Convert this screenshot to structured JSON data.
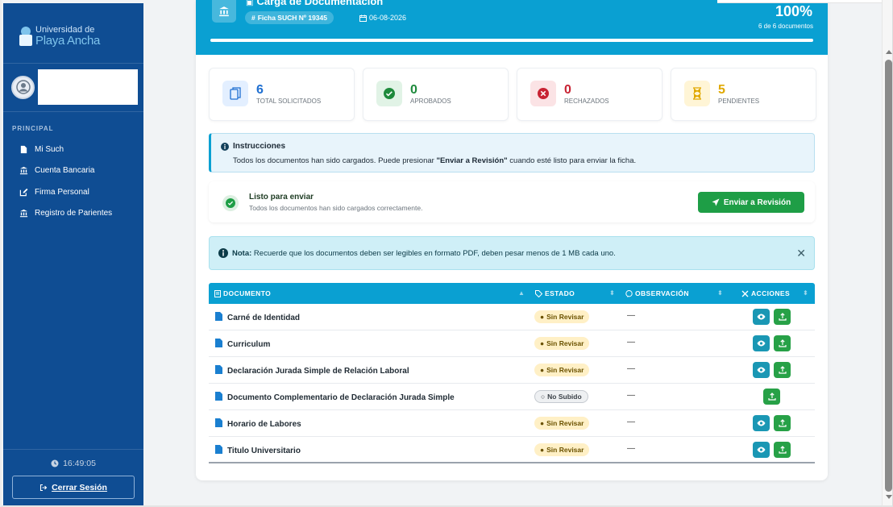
{
  "sidebar": {
    "brand_line1": "Universidad de",
    "brand_line2": "Playa Ancha",
    "section": "PRINCIPAL",
    "items": [
      {
        "label": "Mi Such",
        "icon": "file-icon"
      },
      {
        "label": "Cuenta Bancaria",
        "icon": "bank-icon"
      },
      {
        "label": "Firma Personal",
        "icon": "edit-icon"
      },
      {
        "label": "Registro de Parientes",
        "icon": "bank-icon"
      }
    ],
    "clock": "16:49:05",
    "logout": "Cerrar Sesión"
  },
  "header": {
    "title": "Carga de Documentación",
    "ficha": "Ficha SUCH Nº 19345",
    "date": "06-08-2026",
    "percent": "100%",
    "progress_fraction": 1.0,
    "docs_count": "6 de 6 documentos"
  },
  "stats": [
    {
      "value": "6",
      "label": "TOTAL SOLICITADOS",
      "color": "#1f6fd1",
      "bg": "#e3efff",
      "icon": "copy-icon"
    },
    {
      "value": "0",
      "label": "APROBADOS",
      "color": "#1e8a3c",
      "bg": "#e1f3e6",
      "icon": "check-circle-icon"
    },
    {
      "value": "0",
      "label": "RECHAZADOS",
      "color": "#c82333",
      "bg": "#fbe3e5",
      "icon": "x-circle-icon"
    },
    {
      "value": "5",
      "label": "PENDIENTES",
      "color": "#e0a800",
      "bg": "#fff5d6",
      "icon": "hourglass-icon"
    }
  ],
  "instructions": {
    "title": "Instrucciones",
    "text_before": "Todos los documentos han sido cargados. Puede presionar ",
    "text_bold": "\"Enviar a Revisión\"",
    "text_after": " cuando esté listo para enviar la ficha."
  },
  "ready": {
    "title": "Listo para enviar",
    "text": "Todos los documentos han sido cargados correctamente.",
    "button": "Enviar a Revisión"
  },
  "note": {
    "label": "Nota:",
    "text": " Recuerde que los documentos deben ser legibles en formato PDF, deben pesar menos de 1 MB cada uno."
  },
  "table": {
    "headers": [
      "DOCUMENTO",
      "ESTADO",
      "OBSERVACIÓN",
      "ACCIONES"
    ],
    "rows": [
      {
        "doc": "Carné de Identidad",
        "status": "Sin Revisar",
        "obs": "—"
      },
      {
        "doc": "Curriculum",
        "status": "Sin Revisar",
        "obs": "—"
      },
      {
        "doc": "Declaración Jurada Simple de Relación Laboral",
        "status": "Sin Revisar",
        "obs": "—"
      },
      {
        "doc": "Documento Complementario de Declaración Jurada Simple",
        "status": "No Subido",
        "obs": "—"
      },
      {
        "doc": "Horario de Labores",
        "status": "Sin Revisar",
        "obs": "—"
      },
      {
        "doc": "Titulo Universitario",
        "status": "Sin Revisar",
        "obs": "—"
      }
    ]
  }
}
